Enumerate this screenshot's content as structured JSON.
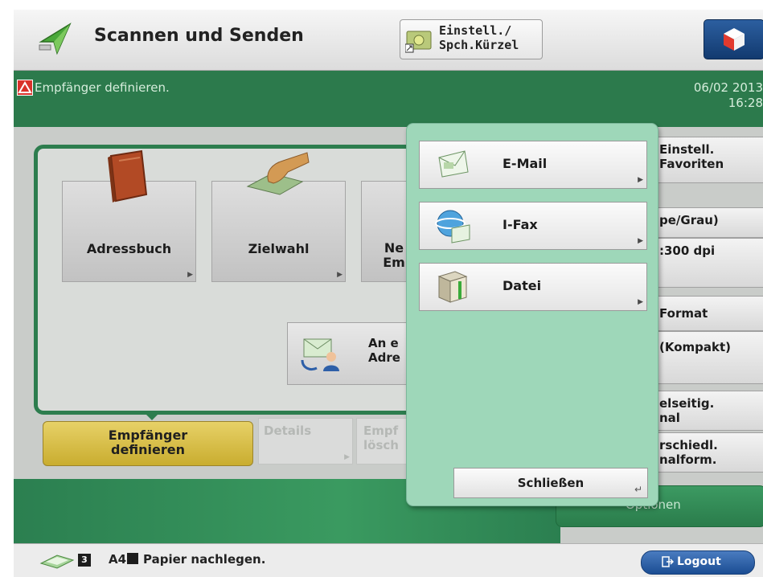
{
  "header": {
    "title": "Scannen und Senden",
    "shortcut_label": "Einstell./\nSpch.Kürzel"
  },
  "status": {
    "message": "Empfänger definieren.",
    "date": "06/02 2013",
    "time": "16:28"
  },
  "destinations": {
    "tiles": [
      "Adressbuch",
      "Zielwahl",
      "Ne\nEm"
    ],
    "send_to_own": "An e\nAdre"
  },
  "tabs": {
    "define": "Empfänger\ndefinieren",
    "details": "Details",
    "delete": "Empf\nlösch"
  },
  "side_settings": {
    "favorites": "Einstell.\nFavoriten",
    "color": "pe/Grau)",
    "resolution": ":300 dpi",
    "format": "Format",
    "file_format": "(Kompakt)",
    "duplex": "elseitig.\nnal",
    "mixed": "rschiedl.\nnalform.",
    "options": "Optionen"
  },
  "popup": {
    "items": [
      "E-Mail",
      "I-Fax",
      "Datei"
    ],
    "close_label": "Schließen"
  },
  "footer": {
    "paper_status": "A4",
    "message": "Papier nachlegen.",
    "logout": "Logout"
  },
  "colors": {
    "status_green": "#2c7a4c",
    "popup_green": "#9ed7b9",
    "define_tab_yellow": "#d8c045",
    "logout_blue": "#2a5fa8"
  }
}
